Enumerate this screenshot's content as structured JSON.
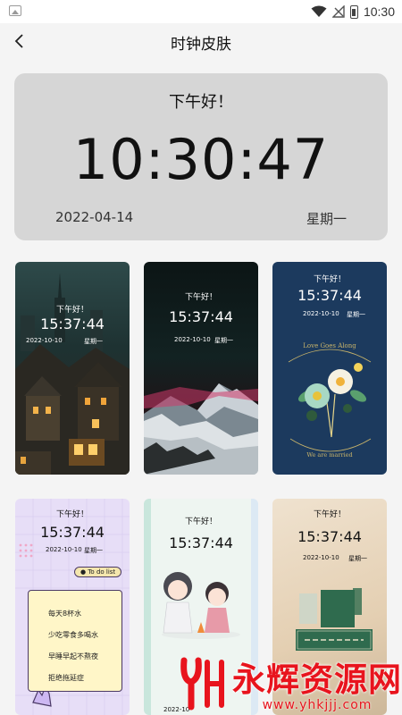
{
  "status_bar": {
    "time": "10:30"
  },
  "header": {
    "title": "时钟皮肤",
    "back_icon": "chevron-left-icon"
  },
  "clock_preview": {
    "greeting": "下午好！",
    "time": "10:30:47",
    "date": "2022-04-14",
    "weekday": "星期一"
  },
  "skins": [
    {
      "greeting": "下午好！",
      "time": "15:37:44",
      "date": "2022-10-10",
      "weekday": "星期一",
      "theme": "night-town"
    },
    {
      "greeting": "下午好！",
      "time": "15:37:44",
      "date": "2022-10-10",
      "weekday": "星期一",
      "theme": "snow-mountain"
    },
    {
      "greeting": "下午好！",
      "time": "15:37:44",
      "date": "2022-10-10",
      "weekday": "星期一",
      "theme": "flowers",
      "decor_top": "Love Goes Along",
      "decor_bottom": "We are married"
    },
    {
      "greeting": "下午好！",
      "time": "15:37:44",
      "date": "2022-10-10",
      "weekday": "星期一",
      "theme": "todo-list",
      "todo_title": "To do list",
      "todo_items": [
        "每天8杯水",
        "少吃零食多喝水",
        "早睡早起不熬夜",
        "拒绝拖延症"
      ]
    },
    {
      "greeting": "下午好！",
      "time": "15:37:44",
      "date": "2022-10-",
      "theme": "cartoon-couple"
    },
    {
      "greeting": "下午好！",
      "time": "15:37:44",
      "date": "2022-10-10",
      "weekday": "星期一",
      "theme": "warm-photos"
    }
  ],
  "watermark": {
    "main": "永辉资源网",
    "sub": "www.yhkjjj.com"
  }
}
